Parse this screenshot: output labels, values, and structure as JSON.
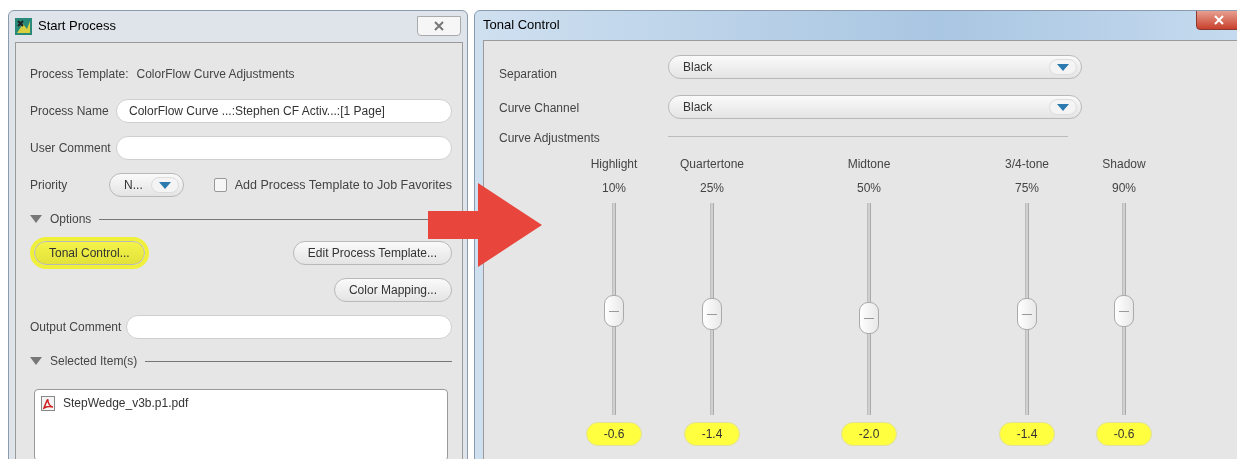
{
  "start_process": {
    "title": "Start  Process",
    "template_label": "Process Template:",
    "template_value": "ColorFlow Curve Adjustments",
    "fields": [
      {
        "label": "Process Name",
        "value": "ColorFlow Curve ...:Stephen CF Activ...:[1 Page]"
      },
      {
        "label": "User Comment"
      }
    ],
    "priority": {
      "label": "Priority",
      "value": "N..."
    },
    "favorites": {
      "label": "Add Process Template to Job Favorites",
      "checked": false
    },
    "options": {
      "label": "Options",
      "expanded": true
    },
    "buttons": [
      {
        "label": "Tonal Control...",
        "highlighted": true
      },
      {
        "label": "Edit Process Template...",
        "highlighted": false
      },
      {
        "label": "Color Mapping...",
        "highlighted": false
      }
    ],
    "output_comment": {
      "label": "Output Comment"
    },
    "selected_items": {
      "label": "Selected Item(s)",
      "expanded": true,
      "files": [
        "StepWedge_v3b.p1.pdf"
      ]
    }
  },
  "tonal_control": {
    "title": "Tonal Control",
    "selects": [
      {
        "label": "Separation",
        "value": "Black"
      },
      {
        "label": "Curve Channel",
        "value": "Black"
      }
    ],
    "curve_label": "Curve Adjustments",
    "sliders": [
      {
        "name": "Highlight",
        "percent": "10%",
        "level": 0.49,
        "value": "-0.6",
        "highlighted": true
      },
      {
        "name": "Quartertone",
        "percent": "25%",
        "level": 0.47,
        "value": "-1.4",
        "highlighted": true
      },
      {
        "name": "Midtone",
        "percent": "50%",
        "level": 0.45,
        "value": "-2.0",
        "highlighted": true
      },
      {
        "name": "3/4-tone",
        "percent": "75%",
        "level": 0.47,
        "value": "-1.4",
        "highlighted": true
      },
      {
        "name": "Shadow",
        "percent": "90%",
        "level": 0.49,
        "value": "-0.6",
        "highlighted": true
      }
    ]
  }
}
